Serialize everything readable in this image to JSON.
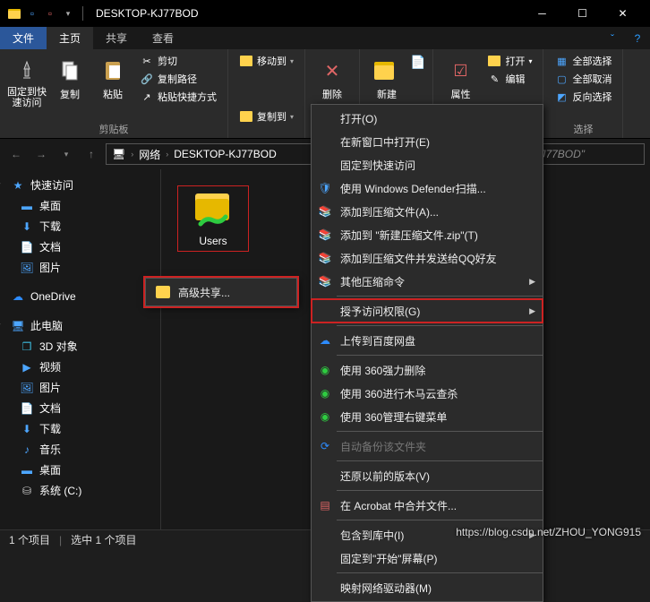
{
  "title": "DESKTOP-KJ77BOD",
  "tabs": {
    "file": "文件",
    "home": "主页",
    "share": "共享",
    "view": "查看"
  },
  "ribbon": {
    "pin": "固定到快\n速访问",
    "copy": "复制",
    "paste": "粘贴",
    "cut": "剪切",
    "copy_path": "复制路径",
    "paste_shortcut": "粘贴快捷方式",
    "clipboard": "剪贴板",
    "move_to": "移动到",
    "copy_to": "复制到",
    "delete": "删除",
    "new": "新建",
    "properties": "属性",
    "open": "打开",
    "edit": "编辑",
    "select_all": "全部选择",
    "select_none": "全部取消",
    "invert": "反向选择",
    "select": "选择"
  },
  "breadcrumb": {
    "network": "网络",
    "host": "DESKTOP-KJ77BOD"
  },
  "search_placeholder": "TOP-KJ77BOD\"",
  "sidebar": {
    "quick": "快速访问",
    "desktop": "桌面",
    "downloads": "下载",
    "documents": "文档",
    "pictures": "图片",
    "onedrive": "OneDrive",
    "thispc": "此电脑",
    "objects3d": "3D 对象",
    "videos": "视频",
    "pictures2": "图片",
    "documents2": "文档",
    "downloads2": "下载",
    "music": "音乐",
    "desktop2": "桌面",
    "system": "系统 (C:)"
  },
  "folder": {
    "users": "Users"
  },
  "menu": {
    "open": "打开(O)",
    "open_new": "在新窗口中打开(E)",
    "pin_quick": "固定到快速访问",
    "defender": "使用 Windows Defender扫描...",
    "add_archive": "添加到压缩文件(A)...",
    "add_zip": "添加到 \"新建压缩文件.zip\"(T)",
    "add_qq": "添加到压缩文件并发送给QQ好友",
    "other_zip": "其他压缩命令",
    "give_access": "授予访问权限(G)",
    "baidu": "上传到百度网盘",
    "sd1": "使用 360强力删除",
    "sd2": "使用 360进行木马云查杀",
    "sd3": "使用 360管理右键菜单",
    "autobak": "自动备份该文件夹",
    "restore": "还原以前的版本(V)",
    "acrobat": "在 Acrobat 中合并文件...",
    "include": "包含到库中(I)",
    "pin_start": "固定到\"开始\"屏幕(P)",
    "map_drive": "映射网络驱动器(M)"
  },
  "submenu": {
    "advanced_share": "高级共享..."
  },
  "status": {
    "count": "1 个项目",
    "selected": "选中 1 个项目"
  },
  "watermark": "https://blog.csdn.net/ZHOU_YONG915"
}
